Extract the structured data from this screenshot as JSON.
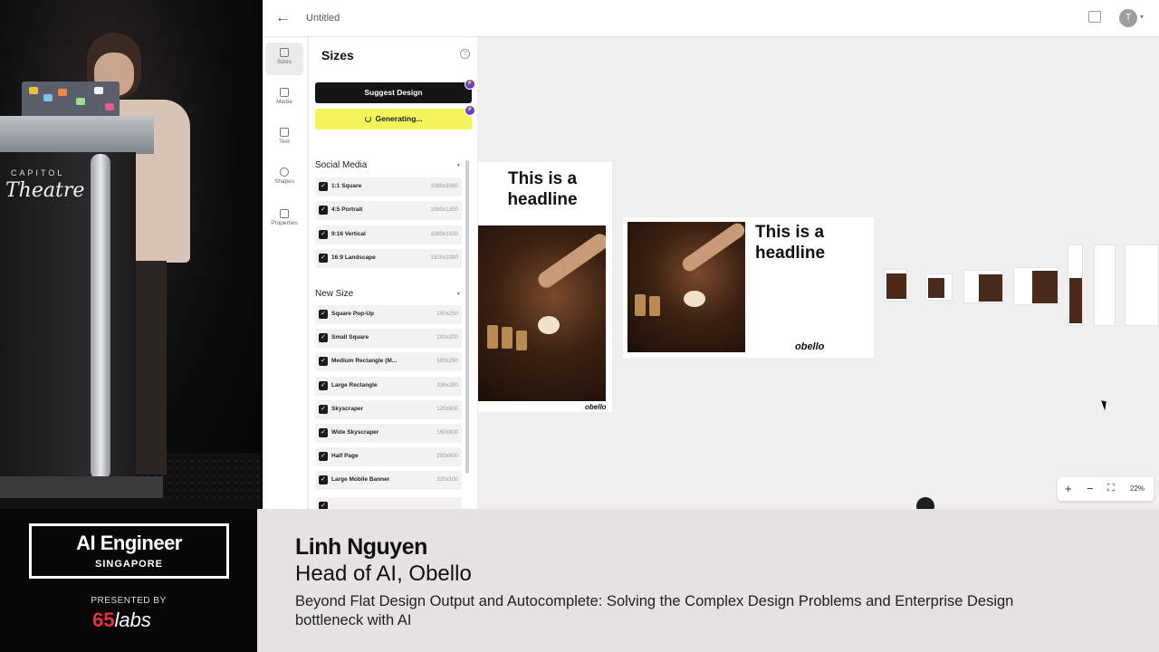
{
  "app": {
    "title": "Untitled",
    "avatar_initial": "T",
    "back_icon": "arrow-left-icon",
    "rail": [
      {
        "label": "Sizes",
        "icon": "sizes-icon",
        "active": true
      },
      {
        "label": "Media",
        "icon": "media-icon",
        "active": false
      },
      {
        "label": "Text",
        "icon": "text-icon",
        "active": false
      },
      {
        "label": "Shapes",
        "icon": "shapes-icon",
        "active": false
      },
      {
        "label": "Properties",
        "icon": "properties-icon",
        "active": false
      }
    ],
    "panel": {
      "title": "Sizes",
      "suggest_label": "Suggest Design",
      "generating_label": "Generating...",
      "social_title": "Social Media",
      "social": [
        {
          "name": "1:1 Square",
          "dim": "1080x1080"
        },
        {
          "name": "4:5 Portrait",
          "dim": "1080x1350"
        },
        {
          "name": "9:16 Vertical",
          "dim": "1080x1920"
        },
        {
          "name": "16:9 Landscape",
          "dim": "1920x1080"
        }
      ],
      "new_title": "New Size",
      "new_sizes": [
        {
          "name": "Square Pop-Up",
          "dim": "250x250"
        },
        {
          "name": "Small Square",
          "dim": "200x200"
        },
        {
          "name": "Medium Rectangle (M...",
          "dim": "300x250"
        },
        {
          "name": "Large Rectangle",
          "dim": "336x280"
        },
        {
          "name": "Skyscraper",
          "dim": "120x600"
        },
        {
          "name": "Wide Skyscraper",
          "dim": "160x600"
        },
        {
          "name": "Half Page",
          "dim": "300x600"
        },
        {
          "name": "Large Mobile Banner",
          "dim": "320x100"
        }
      ]
    },
    "canvas": {
      "headline": "This is a headline",
      "logo": "obello",
      "zoom": "22%"
    },
    "colors": {
      "accent": "#6a3bd9",
      "generating": "#f3f55a"
    }
  },
  "stage": {
    "venue_top": "CAPITOL",
    "venue_bottom": "Theatre"
  },
  "lower_third": {
    "event_title": "AI Engineer",
    "event_sub": "SINGAPORE",
    "presented_by": "PRESENTED BY",
    "sponsor_num": "65",
    "sponsor_word": "labs",
    "speaker_name": "Linh Nguyen",
    "speaker_role": "Head of AI, Obello",
    "talk_title": "Beyond Flat Design Output and Autocomplete: Solving the Complex Design Problems and Enterprise Design bottleneck with AI"
  }
}
